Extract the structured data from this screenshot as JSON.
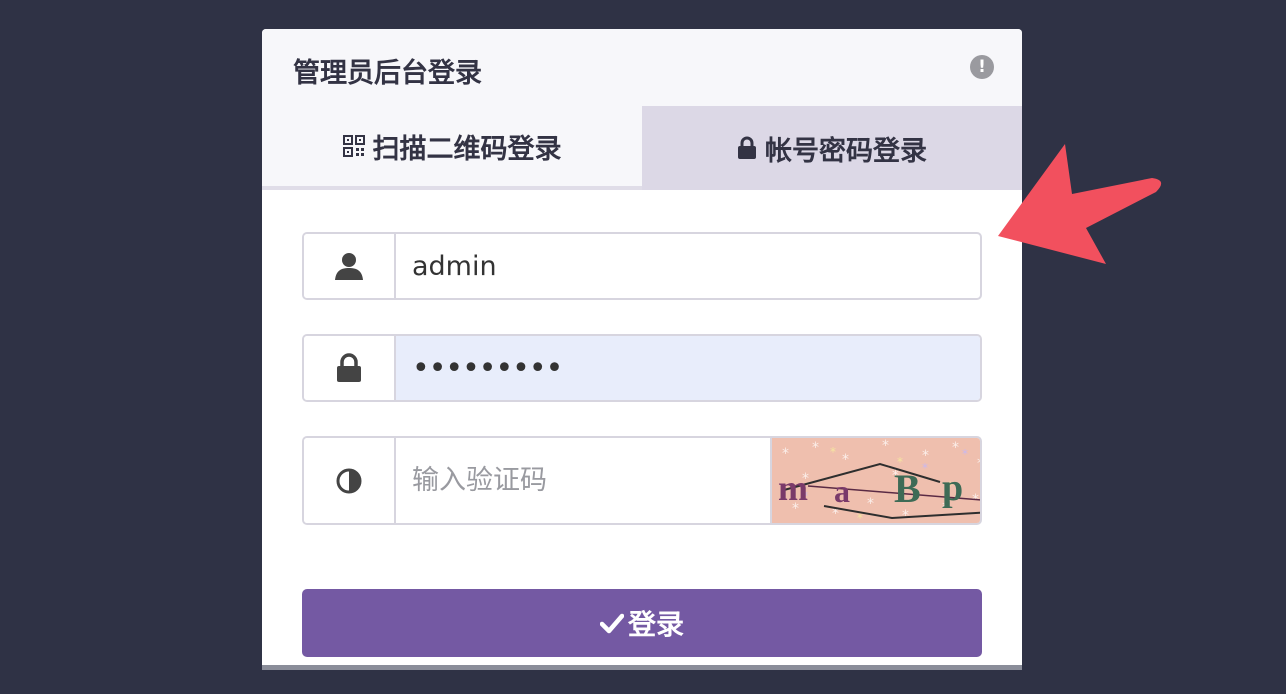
{
  "header": {
    "title": "管理员后台登录",
    "info_icon": "exclamation-circle-icon"
  },
  "tabs": [
    {
      "label": "扫描二维码登录",
      "icon": "qr-code-icon",
      "active": false
    },
    {
      "label": "帐号密码登录",
      "icon": "lock-icon",
      "active": true
    }
  ],
  "form": {
    "username": {
      "value": "admin",
      "icon": "user-icon"
    },
    "password": {
      "value": "•••••••••",
      "icon": "lock-icon"
    },
    "captcha": {
      "placeholder": "输入验证码",
      "icon": "half-circle-icon",
      "image_text": "maBp"
    },
    "submit_label": "登录",
    "submit_icon": "check-icon"
  },
  "colors": {
    "background": "#2f3245",
    "accent": "#7459a3",
    "arrow": "#f2505e"
  }
}
